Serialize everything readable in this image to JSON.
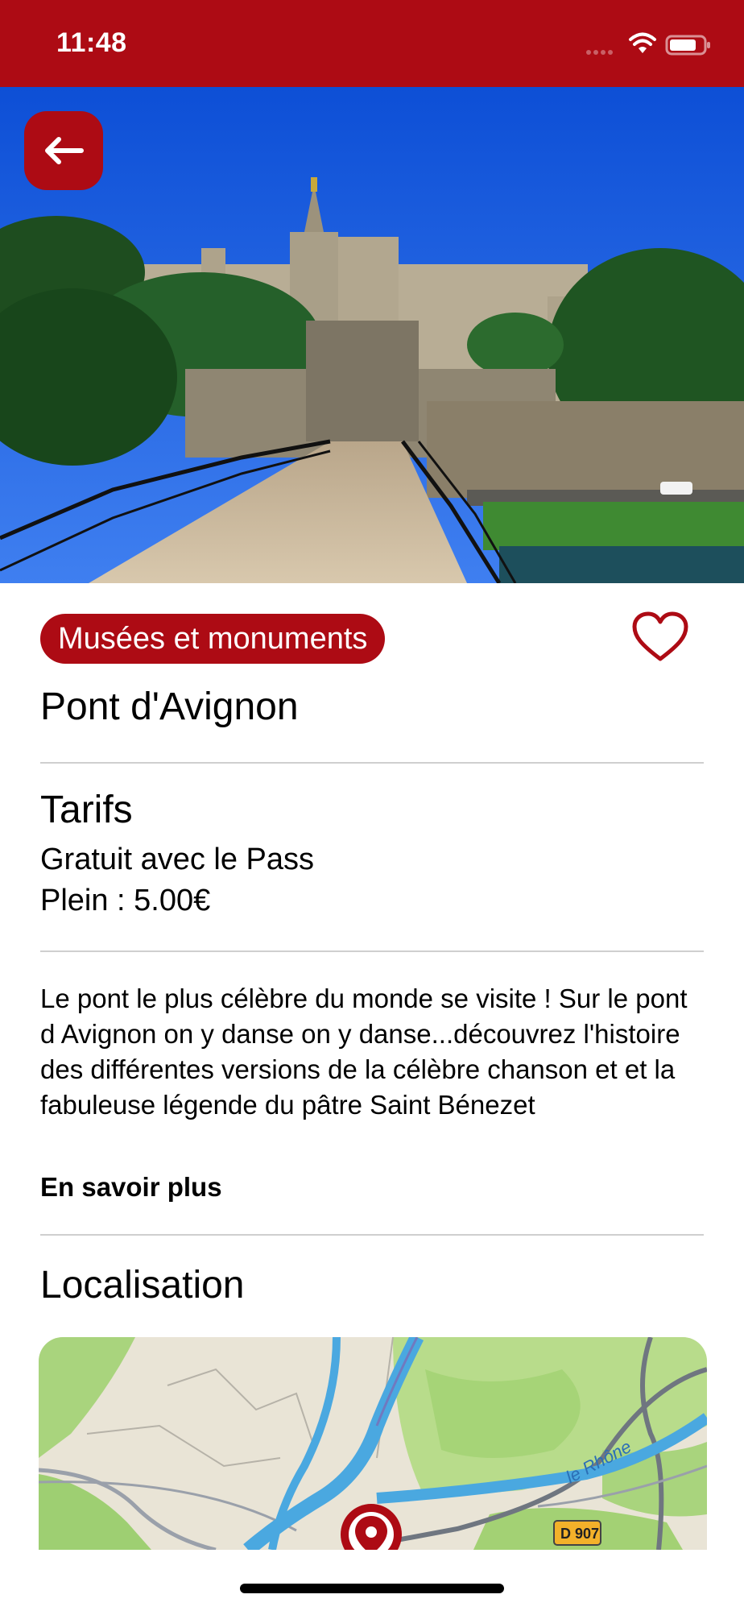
{
  "status_bar": {
    "time": "11:48",
    "icons": [
      "signal-dots",
      "wifi-icon",
      "battery-icon"
    ],
    "color": "#ad0b14"
  },
  "header": {
    "back_icon": "arrow-left-icon"
  },
  "place": {
    "category": "Musées et monuments",
    "title": "Pont d'Avignon",
    "favorite_icon": "heart-outline-icon"
  },
  "tarifs": {
    "title": "Tarifs",
    "lines": [
      "Gratuit avec le Pass",
      "Plein : 5.00€"
    ]
  },
  "description": {
    "text": "Le pont le plus célèbre du monde se visite ! Sur le pont d Avignon on y danse on y danse...découvrez l'histoire des différentes versions de la célèbre chanson et et la fabuleuse légende du pâtre Saint Bénezet",
    "more_label": "En savoir plus"
  },
  "location": {
    "title": "Localisation",
    "map_labels": {
      "river": "le Rhône",
      "road": "D 907"
    },
    "marker_icon": "map-pin-icon"
  },
  "colors": {
    "accent": "#ad0b14",
    "divider": "#cfcfcf",
    "text": "#000000"
  }
}
